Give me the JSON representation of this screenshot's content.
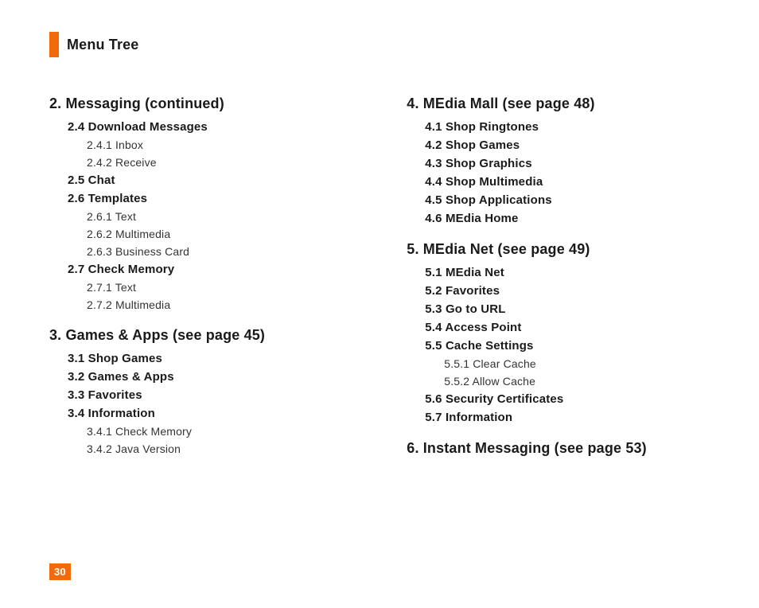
{
  "header": {
    "title": "Menu Tree"
  },
  "page_number": "30",
  "left_sections": [
    {
      "title": "2.  Messaging (continued)",
      "items": [
        {
          "type": "sub1",
          "text": "2.4 Download Messages"
        },
        {
          "type": "sub2",
          "text": "2.4.1 Inbox"
        },
        {
          "type": "sub2",
          "text": "2.4.2 Receive"
        },
        {
          "type": "sub1",
          "text": "2.5 Chat"
        },
        {
          "type": "sub1",
          "text": "2.6 Templates"
        },
        {
          "type": "sub2",
          "text": "2.6.1 Text"
        },
        {
          "type": "sub2",
          "text": "2.6.2 Multimedia"
        },
        {
          "type": "sub2",
          "text": "2.6.3 Business Card"
        },
        {
          "type": "sub1",
          "text": "2.7 Check Memory"
        },
        {
          "type": "sub2",
          "text": "2.7.1 Text"
        },
        {
          "type": "sub2",
          "text": "2.7.2 Multimedia"
        }
      ]
    },
    {
      "title": "3.  Games & Apps (see page 45)",
      "items": [
        {
          "type": "sub1",
          "text": "3.1 Shop Games"
        },
        {
          "type": "sub1",
          "text": "3.2 Games & Apps"
        },
        {
          "type": "sub1",
          "text": "3.3 Favorites"
        },
        {
          "type": "sub1",
          "text": "3.4 Information"
        },
        {
          "type": "sub2",
          "text": "3.4.1 Check Memory"
        },
        {
          "type": "sub2",
          "text": "3.4.2 Java Version"
        }
      ]
    }
  ],
  "right_sections": [
    {
      "title": "4.  MEdia Mall (see page 48)",
      "items": [
        {
          "type": "sub1",
          "text": "4.1 Shop Ringtones"
        },
        {
          "type": "sub1",
          "text": "4.2 Shop Games"
        },
        {
          "type": "sub1",
          "text": "4.3 Shop Graphics"
        },
        {
          "type": "sub1",
          "text": "4.4 Shop Multimedia"
        },
        {
          "type": "sub1",
          "text": "4.5 Shop Applications"
        },
        {
          "type": "sub1",
          "text": "4.6 MEdia Home"
        }
      ]
    },
    {
      "title": "5.  MEdia Net (see page 49)",
      "items": [
        {
          "type": "sub1",
          "text": "5.1 MEdia Net"
        },
        {
          "type": "sub1",
          "text": "5.2 Favorites"
        },
        {
          "type": "sub1",
          "text": "5.3 Go to URL"
        },
        {
          "type": "sub1",
          "text": "5.4 Access Point"
        },
        {
          "type": "sub1",
          "text": "5.5 Cache Settings"
        },
        {
          "type": "sub2",
          "text": "5.5.1 Clear Cache"
        },
        {
          "type": "sub2",
          "text": "5.5.2 Allow Cache"
        },
        {
          "type": "sub1",
          "text": "5.6 Security Certificates"
        },
        {
          "type": "sub1",
          "text": "5.7 Information"
        }
      ]
    },
    {
      "title": "6.  Instant Messaging (see page 53)",
      "items": []
    }
  ]
}
